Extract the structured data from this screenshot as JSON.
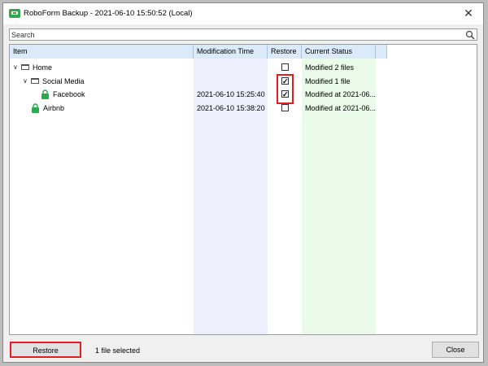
{
  "window": {
    "title": "RoboForm Backup - 2021-06-10 15:50:52 (Local)",
    "close_glyph": "✕"
  },
  "search": {
    "placeholder": "Search",
    "value": ""
  },
  "table": {
    "columns": [
      "Item",
      "Modification Time",
      "Restore",
      "Current Status"
    ],
    "rows": [
      {
        "item": "Home",
        "type": "folder",
        "expanded": true,
        "modification_time": "",
        "restore": false,
        "status": "Modified 2 files"
      },
      {
        "item": "Social Media",
        "type": "folder",
        "expanded": true,
        "modification_time": "",
        "restore": true,
        "status": "Modified 1 file"
      },
      {
        "item": "Facebook",
        "type": "login",
        "modification_time": "2021-06-10 15:25:40",
        "restore": true,
        "status": "Modified at 2021-06..."
      },
      {
        "item": "Airbnb",
        "type": "login",
        "modification_time": "2021-06-10 15:38:20",
        "restore": false,
        "status": "Modified at 2021-06..."
      }
    ]
  },
  "footer": {
    "restore_label": "Restore",
    "status": "1 file selected",
    "close_label": "Close"
  },
  "colors": {
    "header_bg": "#dbeaf9",
    "mod_time_column_bg": "#eeeefc",
    "status_column_bg": "#eafbea",
    "highlight": "#e02020",
    "lock_green": "#2fa84f"
  },
  "icons": {
    "app": "roboform-icon",
    "folder": "folder-icon",
    "login": "lock-icon",
    "expand": "chevron-down-icon",
    "search": "search-icon"
  }
}
